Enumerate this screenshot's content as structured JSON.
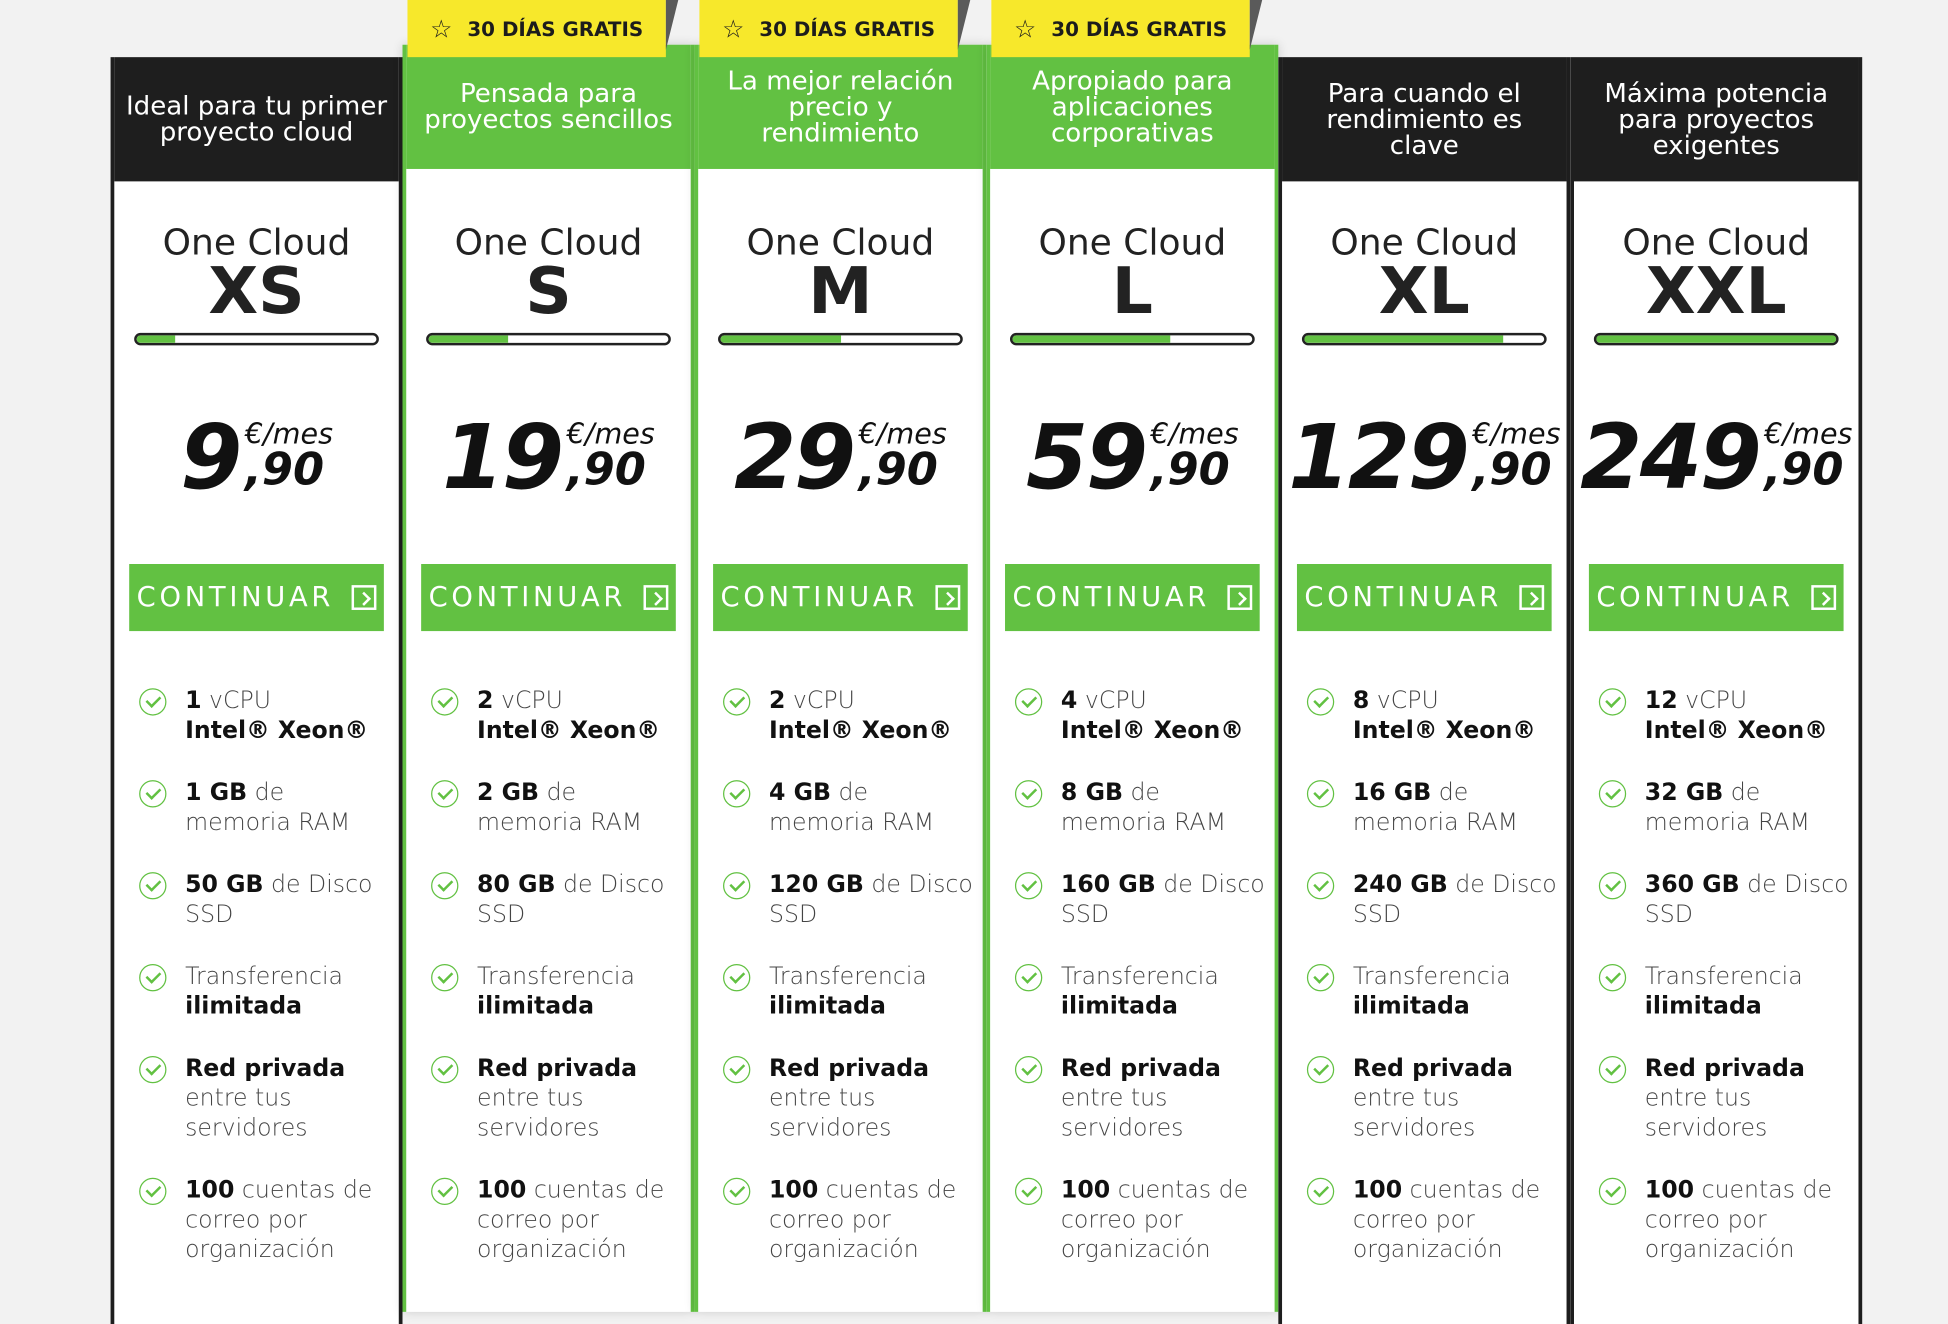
{
  "ribbon_text": "30 DÍAS GRATIS",
  "button_label": "CONTINUAR",
  "price_unit": "€/mes",
  "price_decimal": ",90",
  "colors": {
    "accent": "#62c142",
    "dark": "#1e1e1e",
    "ribbon": "#f7e82b"
  },
  "plans": [
    {
      "tagline": "Ideal para tu primer proyecto cloud",
      "pre": "One Cloud",
      "size": "XS",
      "price": "9",
      "level": 0.16,
      "features": [
        [
          "1",
          " vCPU",
          "Intel® Xeon®"
        ],
        [
          "1 GB",
          " de memoria RAM"
        ],
        [
          "50 GB",
          " de Disco SSD"
        ],
        [
          "Transferencia ",
          "ilimitada"
        ],
        [
          "Red privada",
          " entre tus servidores"
        ],
        [
          "100",
          " cuentas de correo por organización"
        ]
      ]
    },
    {
      "tagline": "Pensada para proyectos sencillos",
      "pre": "One Cloud",
      "size": "S",
      "price": "19",
      "level": 0.33,
      "features": [
        [
          "2",
          " vCPU",
          "Intel® Xeon®"
        ],
        [
          "2 GB",
          " de memoria RAM"
        ],
        [
          "80 GB",
          " de Disco SSD"
        ],
        [
          "Transferencia ",
          "ilimitada"
        ],
        [
          "Red privada",
          " entre tus servidores"
        ],
        [
          "100",
          " cuentas de correo por organización"
        ]
      ]
    },
    {
      "tagline": "La mejor relación precio y rendimiento",
      "pre": "One Cloud",
      "size": "M",
      "price": "29",
      "level": 0.5,
      "features": [
        [
          "2",
          " vCPU",
          "Intel® Xeon®"
        ],
        [
          "4 GB",
          " de memoria RAM"
        ],
        [
          "120 GB",
          " de Disco SSD"
        ],
        [
          "Transferencia ",
          "ilimitada"
        ],
        [
          "Red privada",
          " entre tus servidores"
        ],
        [
          "100",
          " cuentas de correo por organización"
        ]
      ]
    },
    {
      "tagline": "Apropiado para aplicaciones corporativas",
      "pre": "One Cloud",
      "size": "L",
      "price": "59",
      "level": 0.66,
      "features": [
        [
          "4",
          " vCPU",
          "Intel® Xeon®"
        ],
        [
          "8 GB",
          " de memoria RAM"
        ],
        [
          "160 GB",
          " de Disco SSD"
        ],
        [
          "Transferencia ",
          "ilimitada"
        ],
        [
          "Red privada",
          " entre tus servidores"
        ],
        [
          "100",
          " cuentas de correo por organización"
        ]
      ]
    },
    {
      "tagline": "Para cuando el rendimiento es clave",
      "pre": "One Cloud",
      "size": "XL",
      "price": "129",
      "level": 0.83,
      "features": [
        [
          "8",
          " vCPU",
          "Intel® Xeon®"
        ],
        [
          "16 GB",
          " de memoria RAM"
        ],
        [
          "240 GB",
          " de Disco SSD"
        ],
        [
          "Transferencia ",
          "ilimitada"
        ],
        [
          "Red privada",
          " entre tus servidores"
        ],
        [
          "100",
          " cuentas de correo por organización"
        ]
      ]
    },
    {
      "tagline": "Máxima potencia para proyectos exigentes",
      "pre": "One Cloud",
      "size": "XXL",
      "price": "249",
      "level": 1.0,
      "features": [
        [
          "12",
          " vCPU",
          "Intel® Xeon®"
        ],
        [
          "32 GB",
          " de memoria RAM"
        ],
        [
          "360 GB",
          " de Disco SSD"
        ],
        [
          "Transferencia ",
          "ilimitada"
        ],
        [
          "Red privada",
          " entre tus servidores"
        ],
        [
          "100",
          " cuentas de correo por organización"
        ]
      ]
    }
  ]
}
